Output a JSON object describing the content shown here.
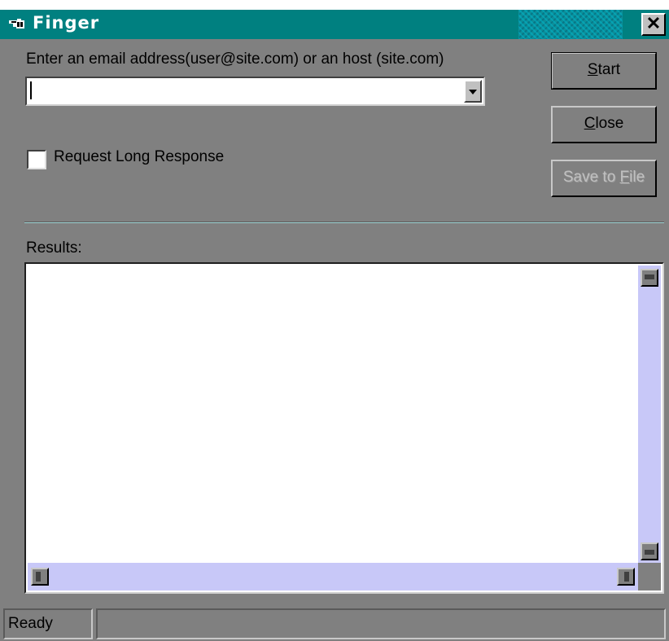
{
  "window": {
    "title": "Finger",
    "close_glyph": "✕"
  },
  "form": {
    "address_label": "Enter an email address(user@site.com) or an host (site.com)",
    "address_value": "",
    "long_response_label": "Request Long Response",
    "long_response_checked": false
  },
  "buttons": {
    "start_pre": "",
    "start_key": "S",
    "start_post": "tart",
    "close_pre": "",
    "close_key": "C",
    "close_post": "lose",
    "save_pre": "Save to ",
    "save_key": "F",
    "save_post": "ile"
  },
  "results": {
    "label": "Results:",
    "text": ""
  },
  "status": {
    "text": "Ready",
    "secondary": ""
  },
  "colors": {
    "titlebar": "#008080",
    "window_bg": "#808080",
    "scrollbar_track": "#c8c8f8"
  },
  "icons": {
    "app": "pointing-hand-icon"
  }
}
